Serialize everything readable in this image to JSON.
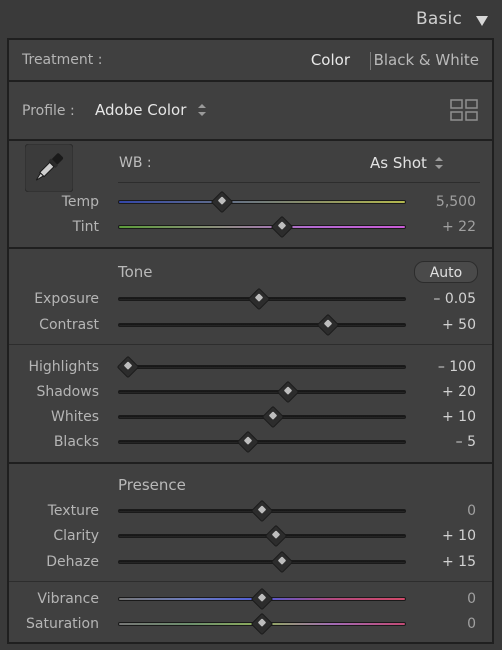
{
  "header": {
    "title": "Basic",
    "collapse_icon": "triangle-down-icon"
  },
  "treatment": {
    "label": "Treatment :",
    "options": [
      "Color",
      "Black & White"
    ],
    "selected": "Color"
  },
  "profile": {
    "label": "Profile :",
    "value": "Adobe Color",
    "browser_icon": "grid-icon"
  },
  "wb": {
    "label": "WB :",
    "value": "As Shot",
    "eyedropper_icon": "eyedropper-icon",
    "temp": {
      "label": "Temp",
      "value": "5,500",
      "position": 0.36
    },
    "tint": {
      "label": "Tint",
      "value": "+ 22",
      "position": 0.57
    }
  },
  "tone": {
    "title": "Tone",
    "auto_label": "Auto",
    "exposure": {
      "label": "Exposure",
      "value": "– 0.05",
      "position": 0.49
    },
    "contrast": {
      "label": "Contrast",
      "value": "+ 50",
      "position": 0.73
    }
  },
  "tonal_ranges": {
    "highlights": {
      "label": "Highlights",
      "value": "– 100",
      "position": 0.03
    },
    "shadows": {
      "label": "Shadows",
      "value": "+ 20",
      "position": 0.59
    },
    "whites": {
      "label": "Whites",
      "value": "+ 10",
      "position": 0.54
    },
    "blacks": {
      "label": "Blacks",
      "value": "– 5",
      "position": 0.45
    }
  },
  "presence": {
    "title": "Presence",
    "texture": {
      "label": "Texture",
      "value": "0",
      "position": 0.5
    },
    "clarity": {
      "label": "Clarity",
      "value": "+ 10",
      "position": 0.55
    },
    "dehaze": {
      "label": "Dehaze",
      "value": "+ 15",
      "position": 0.57
    }
  },
  "color_sat": {
    "vibrance": {
      "label": "Vibrance",
      "value": "0",
      "position": 0.5
    },
    "saturation": {
      "label": "Saturation",
      "value": "0",
      "position": 0.5
    }
  },
  "colors": {
    "background": "#3a3a3a",
    "panel": "#404040",
    "border": "#1f1f1f"
  }
}
